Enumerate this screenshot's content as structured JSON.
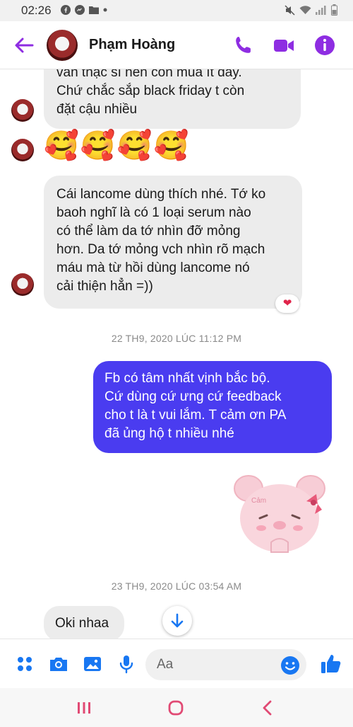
{
  "status_bar": {
    "time": "02:26"
  },
  "header": {
    "contact_name": "Phạm Hoàng",
    "accent_color": "#8e2de2"
  },
  "messages": [
    {
      "id": "m1",
      "direction": "incoming",
      "text": "vẫn thạc sĩ nên còn mua ít đây.\nChứ chắc sắp black friday t còn\nđặt cậu nhiều"
    },
    {
      "id": "m2",
      "direction": "incoming",
      "emojis": [
        "🥰",
        "🥰",
        "🥰",
        "🥰"
      ]
    },
    {
      "id": "m3",
      "direction": "incoming",
      "text": "Cái lancome dùng thích nhé. Tớ ko\nbaoh nghĩ là có 1 loại serum nào\ncó thể làm da tớ nhìn đỡ mỏng\nhơn. Da tớ mỏng vch nhìn rõ mạch\nmáu mà từ hồi dùng lancome nó\ncải thiện hẳn =))",
      "reaction": "❤"
    },
    {
      "id": "ts1",
      "type": "timestamp",
      "text": "22 TH9, 2020 LÚC 11:12 PM"
    },
    {
      "id": "m4",
      "direction": "outgoing",
      "text": "Fb có tâm nhất vịnh bắc bộ.\nCứ dùng cứ ưng cứ feedback\ncho t là t vui lắm. T cảm ơn PA\nđã ủng hộ t nhiều nhé"
    },
    {
      "id": "m5",
      "direction": "outgoing",
      "sticker": "pink-bear-thanks-sticker",
      "sticker_text": "Cảm"
    },
    {
      "id": "ts2",
      "type": "timestamp",
      "text": "23 TH9, 2020 LÚC 03:54 AM"
    },
    {
      "id": "m6",
      "direction": "incoming",
      "text": "Oki nhaa"
    }
  ],
  "composer": {
    "placeholder": "Aa"
  },
  "colors": {
    "outgoing_bubble": "#4a3cf0",
    "incoming_bubble": "#ececec",
    "icon_blue": "#1877f2",
    "header_icons": "#8e2de2"
  },
  "icons": {
    "back": "back-arrow-icon",
    "call": "phone-icon",
    "video": "video-camera-icon",
    "info": "info-icon",
    "menu": "four-dots-icon",
    "camera": "camera-icon",
    "gallery": "image-icon",
    "mic": "microphone-icon",
    "emoji": "smiley-icon",
    "like": "thumbs-up-icon",
    "scroll": "arrow-down-icon"
  }
}
